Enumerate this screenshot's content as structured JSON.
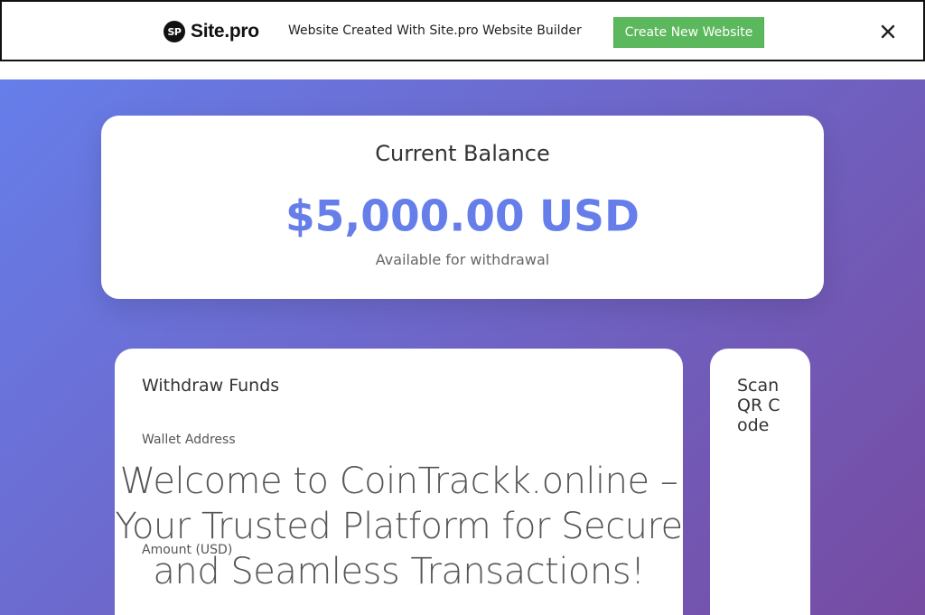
{
  "banner": {
    "logo_badge": "SP",
    "logo_text": "Site.pro",
    "message": "Website Created With Site.pro Website Builder",
    "create_button": "Create New Website",
    "close_icon": "close-icon",
    "button_color": "#5cb85c"
  },
  "balance": {
    "title": "Current Balance",
    "amount": "$5,000.00 USD",
    "subtitle": "Available for withdrawal",
    "accent_color": "#667eea"
  },
  "withdraw": {
    "title": "Withdraw Funds",
    "wallet_label": "Wallet Address",
    "amount_label": "Amount (USD)"
  },
  "overlay": {
    "welcome_text": "Welcome to CoinTrackk.online – Your Trusted Platform for Secure and Seamless Transactions!"
  },
  "qr": {
    "title": "Scan QR Code"
  },
  "background": {
    "gradient_start": "#667eea",
    "gradient_end": "#764ba2"
  }
}
